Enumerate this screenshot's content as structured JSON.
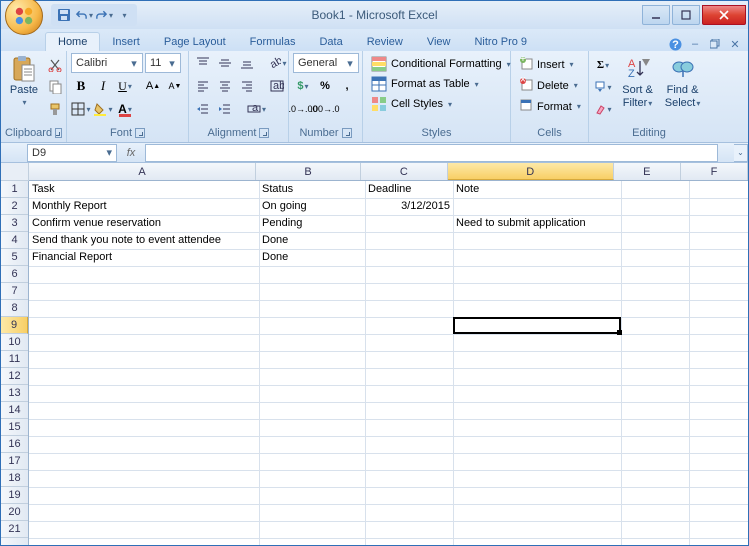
{
  "window": {
    "title": "Book1 - Microsoft Excel"
  },
  "tabs": {
    "home": "Home",
    "insert": "Insert",
    "page_layout": "Page Layout",
    "formulas": "Formulas",
    "data": "Data",
    "review": "Review",
    "view": "View",
    "nitro": "Nitro Pro 9"
  },
  "clipboard": {
    "paste": "Paste",
    "label": "Clipboard"
  },
  "font": {
    "name": "Calibri",
    "size": "11",
    "label": "Font"
  },
  "alignment": {
    "label": "Alignment"
  },
  "number": {
    "format": "General",
    "label": "Number"
  },
  "styles": {
    "cond": "Conditional Formatting",
    "table": "Format as Table",
    "cell": "Cell Styles",
    "label": "Styles"
  },
  "cells": {
    "insert": "Insert",
    "delete": "Delete",
    "format": "Format",
    "label": "Cells"
  },
  "editing": {
    "sort": "Sort & Filter",
    "find": "Find & Select",
    "label": "Editing"
  },
  "namebox": {
    "ref": "D9"
  },
  "cols": {
    "A": "A",
    "B": "B",
    "C": "C",
    "D": "D",
    "E": "E",
    "F": "F"
  },
  "sheet": {
    "headers": {
      "task": "Task",
      "status": "Status",
      "deadline": "Deadline",
      "note": "Note"
    },
    "rows": [
      {
        "task": "Monthly Report",
        "status": "On going",
        "deadline": "3/12/2015",
        "note": ""
      },
      {
        "task": "Confirm venue reservation",
        "status": "Pending",
        "deadline": "",
        "note": "Need to submit application"
      },
      {
        "task": "Send thank you note to event attendee",
        "status": "Done",
        "deadline": "",
        "note": ""
      },
      {
        "task": "Financial Report",
        "status": "Done",
        "deadline": "",
        "note": ""
      }
    ]
  }
}
